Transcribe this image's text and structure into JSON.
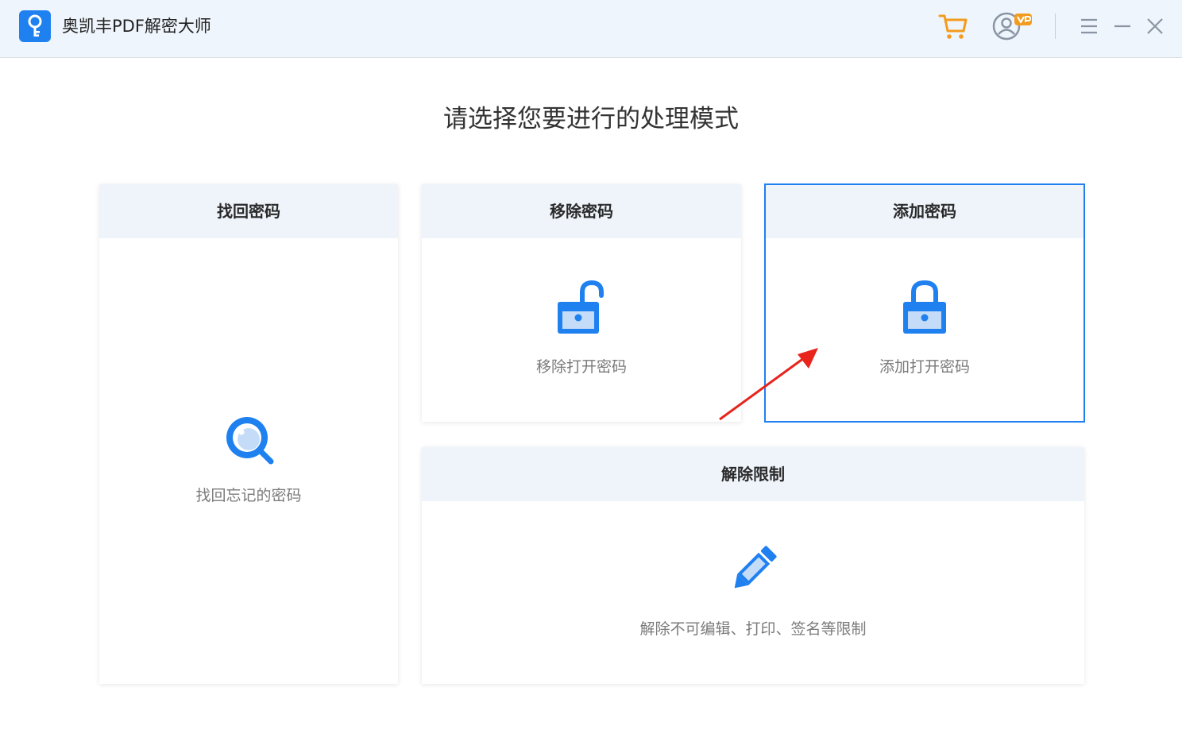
{
  "app": {
    "title": "奥凯丰PDF解密大师",
    "logo_icon": "key-icon",
    "accent_color": "#1f80f0",
    "cart_color": "#f39b1e"
  },
  "titlebar": {
    "icons": [
      "cart-icon",
      "user-vip-icon",
      "menu-icon",
      "minimize-icon",
      "close-icon"
    ]
  },
  "main": {
    "heading": "请选择您要进行的处理模式",
    "cards": [
      {
        "id": "recover",
        "title": "找回密码",
        "description": "找回忘记的密码",
        "icon": "magnifier-icon",
        "selected": false
      },
      {
        "id": "remove",
        "title": "移除密码",
        "description": "移除打开密码",
        "icon": "unlock-icon",
        "selected": false
      },
      {
        "id": "add",
        "title": "添加密码",
        "description": "添加打开密码",
        "icon": "lock-icon",
        "selected": true
      },
      {
        "id": "unrestrict",
        "title": "解除限制",
        "description": "解除不可编辑、打印、签名等限制",
        "icon": "pencil-icon",
        "selected": false
      }
    ]
  }
}
